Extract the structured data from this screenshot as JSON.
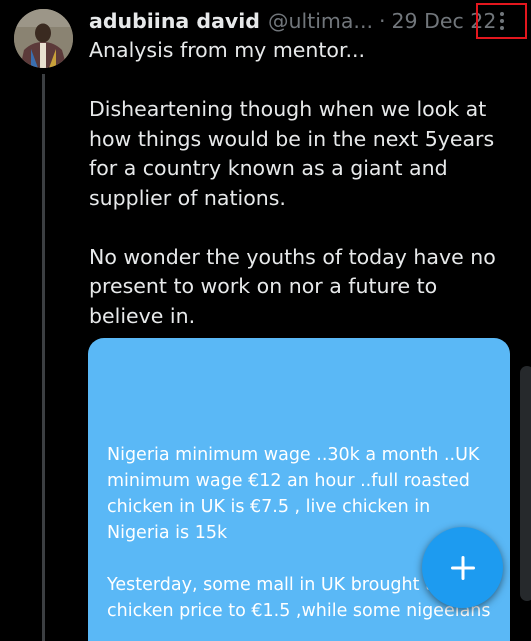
{
  "post": {
    "author_name": "adubiina david",
    "author_handle": "@ultima...",
    "separator": "·",
    "date": "29 Dec 22",
    "paragraphs": [
      "Analysis from my mentor...",
      "Disheartening though when we look at how things would be in the next 5years for a country known as a giant and supplier of nations.",
      "No wonder the youths of today have no present to work on nor a future to believe in."
    ]
  },
  "media": {
    "paragraphs": [
      "Nigeria minimum wage ..30k a month ..UK minimum wage €12 an hour ..full roasted chicken in UK is €7.5 , live chicken in Nigeria is 15k",
      "Yesterday, some mall in UK brought the chicken price to €1.5 ,while some nigeeians"
    ],
    "background_color": "#5ab8f6"
  },
  "icons": {
    "more": "more-vertical-icon",
    "compose": "plus-icon"
  },
  "colors": {
    "background": "#000000",
    "text": "#e7e9ea",
    "muted": "#71767b",
    "accent": "#1d9bf0",
    "highlight": "#e3171e"
  }
}
